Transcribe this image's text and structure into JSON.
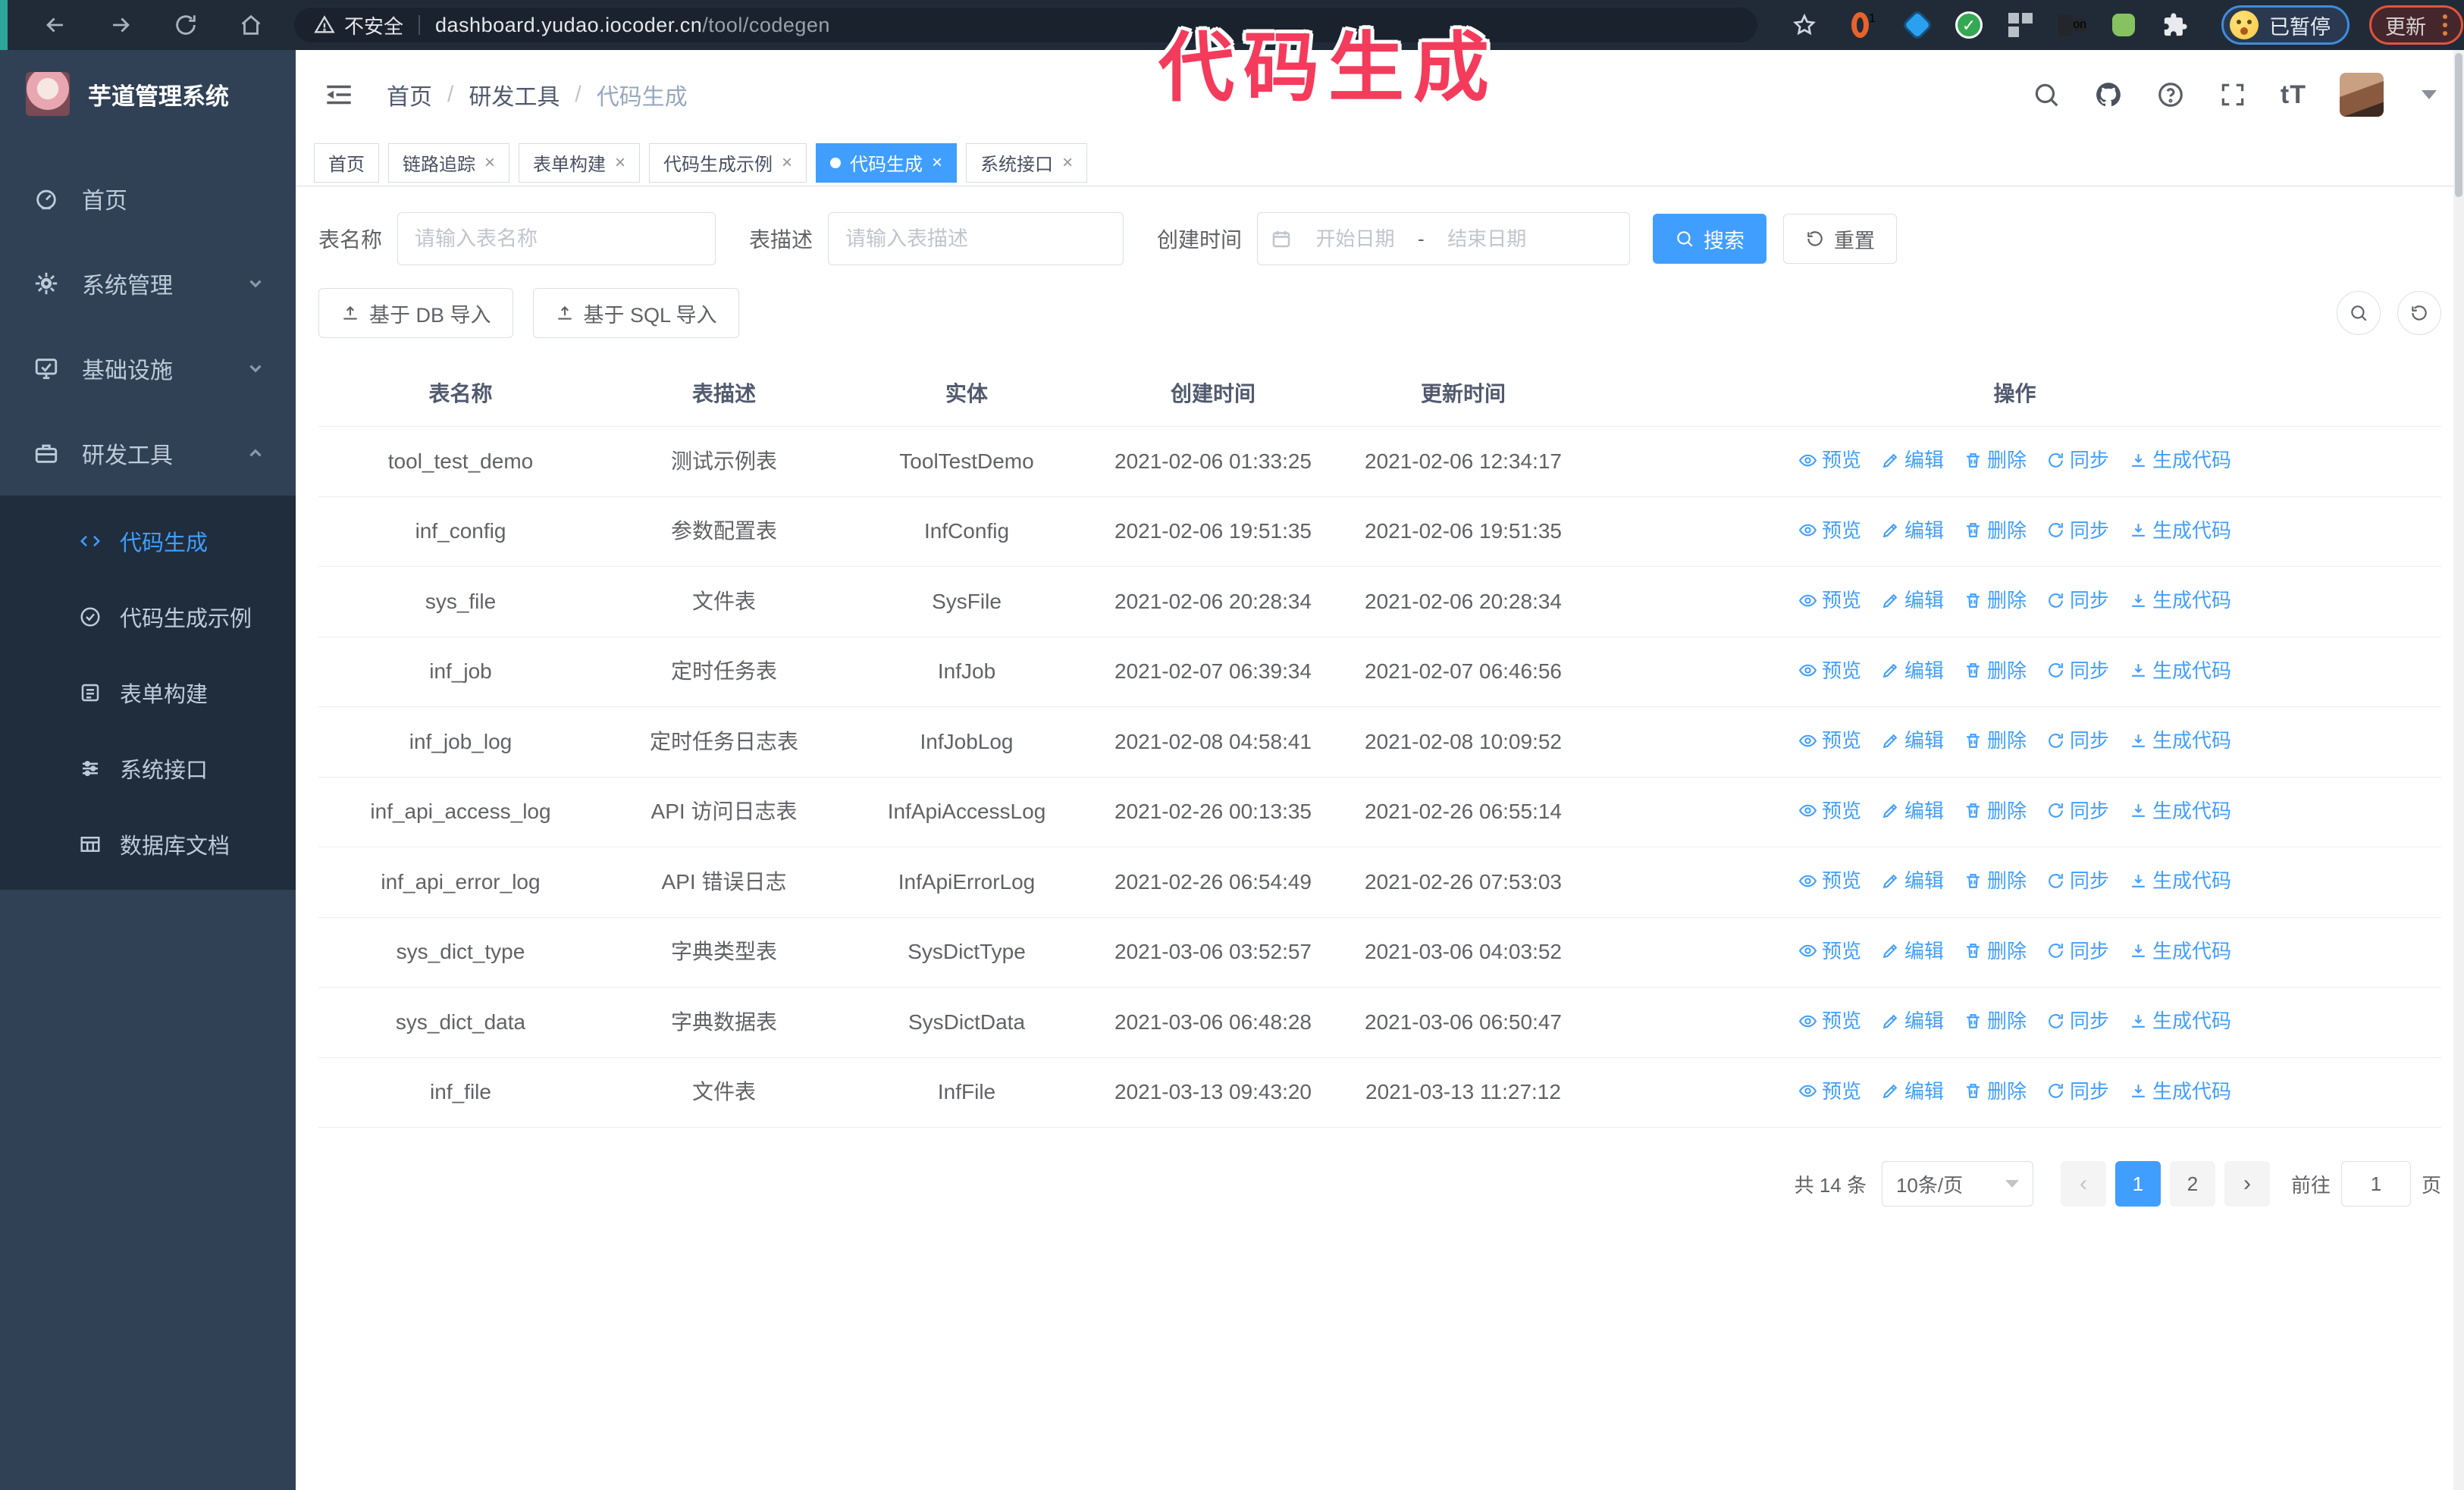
{
  "colors": {
    "accent": "#409eff",
    "sidebar_bg": "#304156",
    "submenu_bg": "#1f2d3d",
    "browser_bar_bg": "#212b38",
    "annotation": "#f43b5c",
    "table_border": "#ebeef5"
  },
  "browser": {
    "security_label": "不安全",
    "url_host": "dashboard.yudao.iocoder.cn",
    "url_path": "/tool/codegen",
    "paused_badge": "已暂停",
    "update_button": "更新"
  },
  "annotation": {
    "text": "代码生成"
  },
  "sidebar": {
    "logo_title": "芋道管理系统",
    "items": [
      {
        "label": "首页",
        "icon": "dashboard-icon"
      },
      {
        "label": "系统管理",
        "icon": "gear-icon",
        "chevron": "down"
      },
      {
        "label": "基础设施",
        "icon": "monitor-icon",
        "chevron": "down"
      },
      {
        "label": "研发工具",
        "icon": "toolbox-icon",
        "chevron": "up",
        "expanded": true
      }
    ],
    "submenu": [
      {
        "label": "代码生成",
        "icon": "code-icon",
        "active": true
      },
      {
        "label": "代码生成示例",
        "icon": "example-icon"
      },
      {
        "label": "表单构建",
        "icon": "form-icon"
      },
      {
        "label": "系统接口",
        "icon": "api-icon"
      },
      {
        "label": "数据库文档",
        "icon": "database-icon"
      }
    ]
  },
  "header": {
    "breadcrumb": [
      "首页",
      "研发工具",
      "代码生成"
    ]
  },
  "tabs": [
    {
      "label": "首页",
      "closable": false,
      "active": false
    },
    {
      "label": "链路追踪",
      "closable": true,
      "active": false
    },
    {
      "label": "表单构建",
      "closable": true,
      "active": false
    },
    {
      "label": "代码生成示例",
      "closable": true,
      "active": false
    },
    {
      "label": "代码生成",
      "closable": true,
      "active": true
    },
    {
      "label": "系统接口",
      "closable": true,
      "active": false
    }
  ],
  "filters": {
    "table_name_label": "表名称",
    "table_name_placeholder": "请输入表名称",
    "table_desc_label": "表描述",
    "table_desc_placeholder": "请输入表描述",
    "create_time_label": "创建时间",
    "date_start_placeholder": "开始日期",
    "date_separator": "-",
    "date_end_placeholder": "结束日期",
    "search_label": "搜索",
    "reset_label": "重置"
  },
  "toolbar": {
    "import_db_label": "基于 DB 导入",
    "import_sql_label": "基于 SQL 导入"
  },
  "table": {
    "columns": [
      "表名称",
      "表描述",
      "实体",
      "创建时间",
      "更新时间",
      "操作"
    ],
    "actions": [
      "预览",
      "编辑",
      "删除",
      "同步",
      "生成代码"
    ],
    "rows": [
      {
        "name": "tool_test_demo",
        "desc": "测试示例表",
        "entity": "ToolTestDemo",
        "created": "2021-02-06 01:33:25",
        "updated": "2021-02-06 12:34:17"
      },
      {
        "name": "inf_config",
        "desc": "参数配置表",
        "entity": "InfConfig",
        "created": "2021-02-06 19:51:35",
        "updated": "2021-02-06 19:51:35"
      },
      {
        "name": "sys_file",
        "desc": "文件表",
        "entity": "SysFile",
        "created": "2021-02-06 20:28:34",
        "updated": "2021-02-06 20:28:34"
      },
      {
        "name": "inf_job",
        "desc": "定时任务表",
        "entity": "InfJob",
        "created": "2021-02-07 06:39:34",
        "updated": "2021-02-07 06:46:56"
      },
      {
        "name": "inf_job_log",
        "desc": "定时任务日志表",
        "entity": "InfJobLog",
        "created": "2021-02-08 04:58:41",
        "updated": "2021-02-08 10:09:52"
      },
      {
        "name": "inf_api_access_log",
        "desc": "API 访问日志表",
        "entity": "InfApiAccessLog",
        "created": "2021-02-26 00:13:35",
        "updated": "2021-02-26 06:55:14"
      },
      {
        "name": "inf_api_error_log",
        "desc": "API 错误日志",
        "entity": "InfApiErrorLog",
        "created": "2021-02-26 06:54:49",
        "updated": "2021-02-26 07:53:03"
      },
      {
        "name": "sys_dict_type",
        "desc": "字典类型表",
        "entity": "SysDictType",
        "created": "2021-03-06 03:52:57",
        "updated": "2021-03-06 04:03:52"
      },
      {
        "name": "sys_dict_data",
        "desc": "字典数据表",
        "entity": "SysDictData",
        "created": "2021-03-06 06:48:28",
        "updated": "2021-03-06 06:50:47"
      },
      {
        "name": "inf_file",
        "desc": "文件表",
        "entity": "InfFile",
        "created": "2021-03-13 09:43:20",
        "updated": "2021-03-13 11:27:12"
      }
    ]
  },
  "pagination": {
    "total": "共 14 条",
    "page_size": "10条/页",
    "pages": [
      "1",
      "2"
    ],
    "active_page": "1",
    "goto_label": "前往",
    "goto_value": "1",
    "page_unit": "页"
  }
}
